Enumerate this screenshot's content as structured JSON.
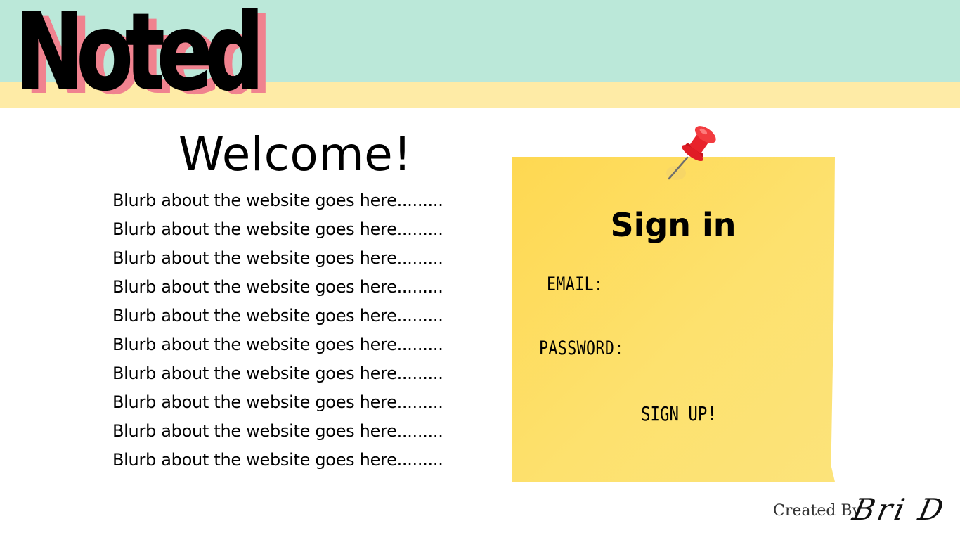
{
  "header": {
    "logo_text": "Noted",
    "colors": {
      "mint": "#bbe8d9",
      "yellow": "#feeba6",
      "logo_shadow": "#f0828f"
    }
  },
  "main": {
    "title": "Welcome!",
    "blurbs": [
      "Blurb about the website goes here.........",
      "Blurb about the website goes here.........",
      "Blurb about the website goes here.........",
      "Blurb about the website goes here.........",
      "Blurb about the website goes here.........",
      "Blurb about the website goes here.........",
      "Blurb about the website goes here.........",
      "Blurb about the website goes here.........",
      "Blurb about the website goes here.........",
      "Blurb about the website goes here........."
    ]
  },
  "signin": {
    "title": "Sign in",
    "email_label": "EMAIL:",
    "password_label": "PASSWORD:",
    "signup_label": "SIGN UP!",
    "note_color": "#fed851",
    "pin_icon": "pushpin-icon"
  },
  "footer": {
    "created_by": "Created By",
    "signature": "Bri D"
  }
}
